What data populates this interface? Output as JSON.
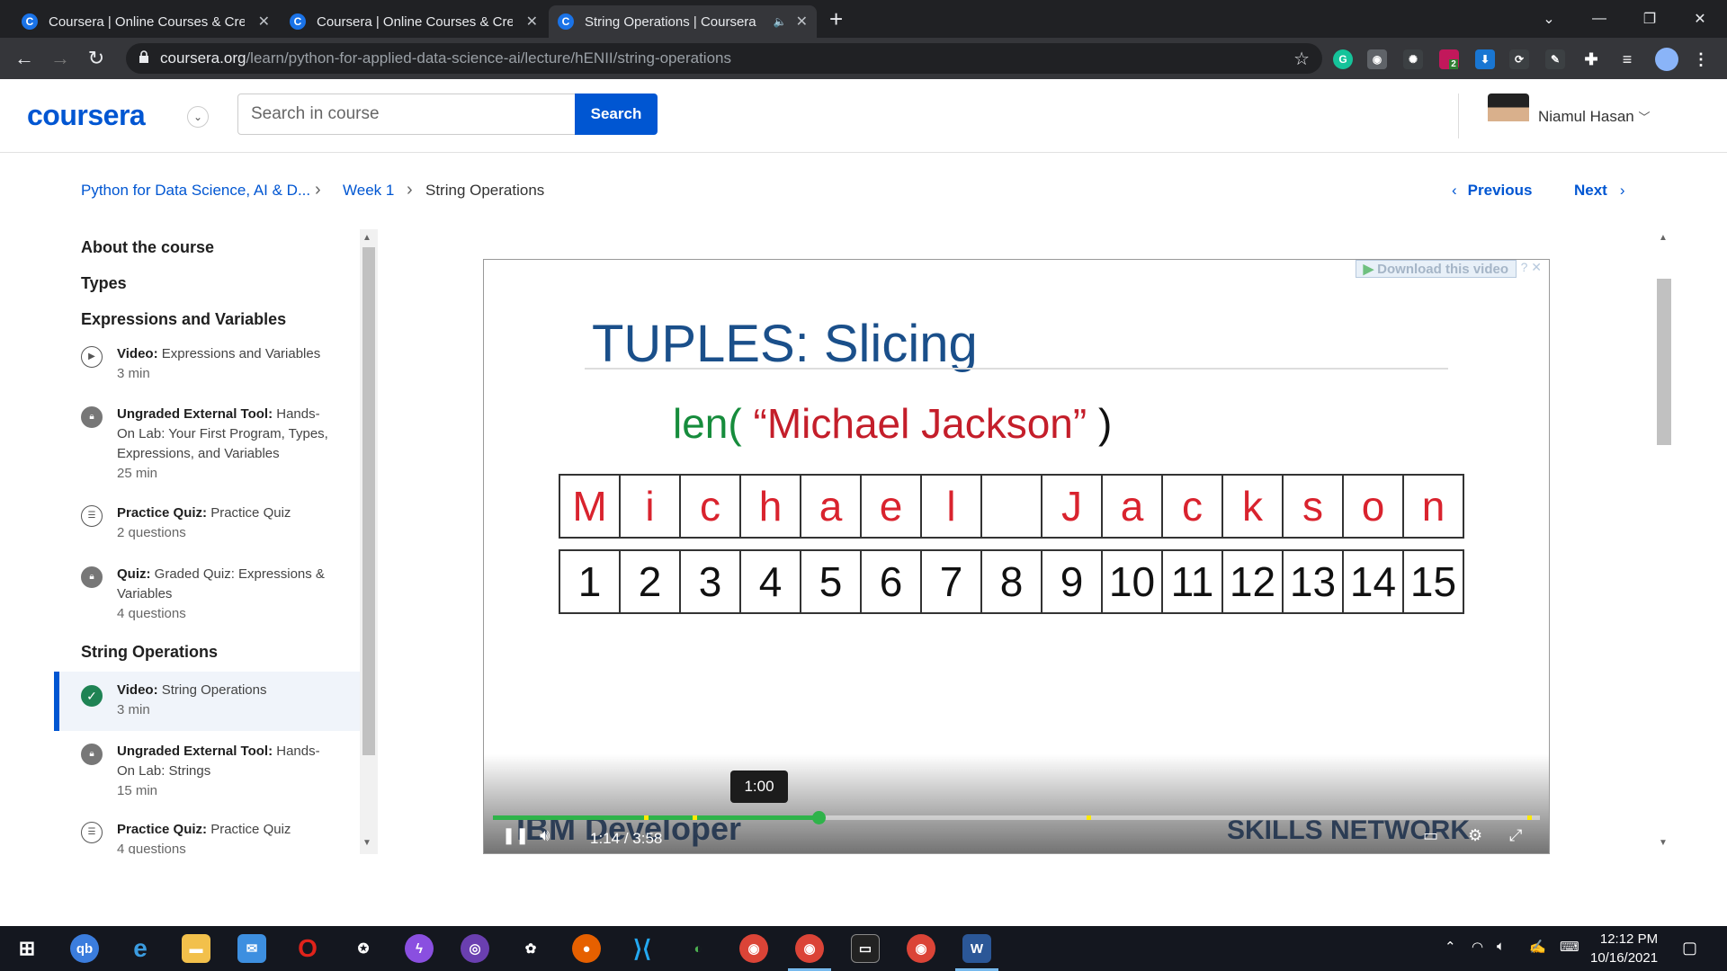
{
  "browser": {
    "tabs": [
      {
        "title": "Coursera | Online Courses & Credentials",
        "active": false
      },
      {
        "title": "Coursera | Online Courses & Credentials",
        "active": false
      },
      {
        "title": "String Operations | Coursera",
        "active": true
      }
    ],
    "url_host": "coursera.org",
    "url_path": "/learn/python-for-applied-data-science-ai/lecture/hENII/string-operations",
    "extension_badge": "2"
  },
  "header": {
    "logo": "coursera",
    "search_placeholder": "Search in course",
    "search_button": "Search",
    "user_name": "Niamul Hasan"
  },
  "breadcrumb": {
    "course": "Python for Data Science, AI & D...",
    "week": "Week 1",
    "current": "String Operations",
    "previous": "Previous",
    "next": "Next"
  },
  "sidebar": {
    "sections": [
      "About the course",
      "Types",
      "Expressions and Variables",
      "String Operations"
    ],
    "items": [
      {
        "type": "Video:",
        "title": "Expressions and Variables",
        "meta": "3 min",
        "icon": "play-icon"
      },
      {
        "type": "Ungraded External Tool:",
        "title": "Hands-On Lab: Your First Program, Types, Expressions, and Variables",
        "meta": "25 min",
        "icon": "lock-icon"
      },
      {
        "type": "Practice Quiz:",
        "title": "Practice Quiz",
        "meta": "2 questions",
        "icon": "quiz-icon"
      },
      {
        "type": "Quiz:",
        "title": "Graded Quiz: Expressions & Variables",
        "meta": "4 questions",
        "icon": "lock-icon"
      },
      {
        "type": "Video:",
        "title": "String Operations",
        "meta": "3 min",
        "icon": "check-icon",
        "active": true
      },
      {
        "type": "Ungraded External Tool:",
        "title": "Hands-On Lab: Strings",
        "meta": "15 min",
        "icon": "lock-icon"
      },
      {
        "type": "Practice Quiz:",
        "title": "Practice Quiz",
        "meta": "4 questions",
        "icon": "quiz-icon"
      }
    ]
  },
  "video": {
    "download_label": "Download this video",
    "slide_title": "TUPLES: Slicing",
    "len_fn": "len(",
    "len_arg": " “Michael Jackson” ",
    "len_close": ")",
    "letters": [
      "M",
      "i",
      "c",
      "h",
      "a",
      "e",
      "l",
      " ",
      "J",
      "a",
      "c",
      "k",
      "s",
      "o",
      "n"
    ],
    "indices": [
      "1",
      "2",
      "3",
      "4",
      "5",
      "6",
      "7",
      "8",
      "9",
      "10",
      "11",
      "12",
      "13",
      "14",
      "15"
    ],
    "hover_time": "1:00",
    "current_time": "1:14",
    "separator": "/",
    "duration": "3:58",
    "progress_fraction": 0.311,
    "watermark_left": "IBM Developer",
    "watermark_right": "SKILLS NETWORK"
  },
  "taskbar": {
    "time": "12:12 PM",
    "date": "10/16/2021"
  },
  "colors": {
    "brand": "#0056d2",
    "progress": "#2fb34a",
    "slide_title": "#1a4f8a",
    "slide_red": "#d9232e",
    "slide_green": "#168c3c"
  }
}
